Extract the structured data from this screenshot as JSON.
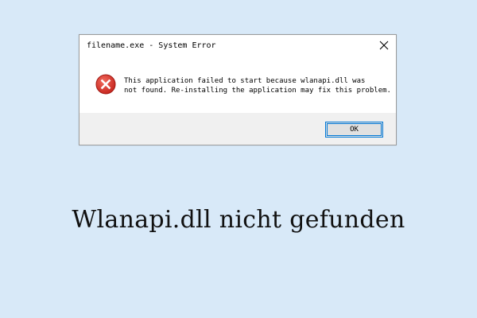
{
  "dialog": {
    "title": "filename.exe - System Error",
    "close_icon": "close-icon",
    "error_icon": "error-icon",
    "message_lines": [
      "This application failed to start because wlanapi.dll was",
      "not found. Re-installing the application may fix this problem."
    ],
    "ok_label": "OK"
  },
  "headline": "Wlanapi.dll nicht gefunden",
  "colors": {
    "background": "#d8e9f8",
    "error_red": "#d9312b",
    "focus_blue": "#0078d7"
  }
}
